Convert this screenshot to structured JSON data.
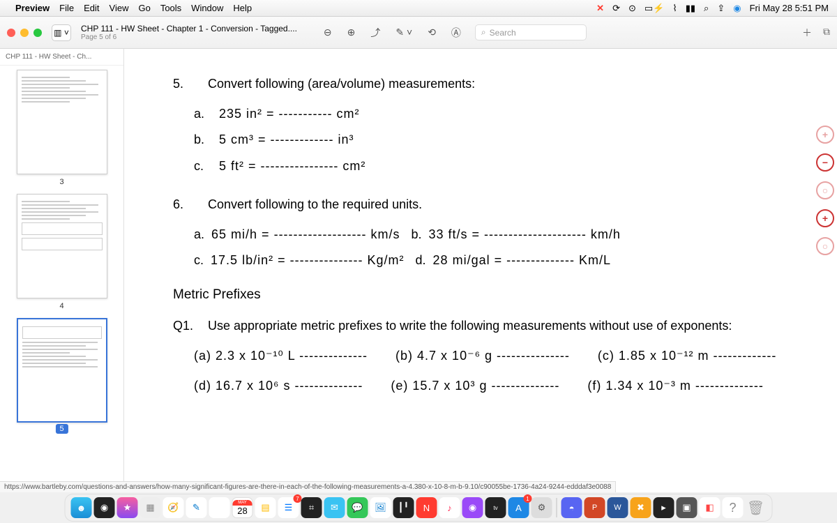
{
  "menubar": {
    "app": "Preview",
    "items": [
      "File",
      "Edit",
      "View",
      "Go",
      "Tools",
      "Window",
      "Help"
    ],
    "datetime": "Fri May 28  5:51 PM"
  },
  "toolbar": {
    "doc_title": "CHP 111 - HW Sheet - Chapter 1 - Conversion - Tagged....",
    "page_info": "Page 5 of 6",
    "search_placeholder": "Search"
  },
  "sidebar": {
    "tab_label": "CHP 111 - HW Sheet - Ch...",
    "thumbs": [
      {
        "num": "3",
        "selected": false
      },
      {
        "num": "4",
        "selected": false
      },
      {
        "num": "5",
        "selected": true
      }
    ]
  },
  "document": {
    "q5": {
      "num": "5.",
      "prompt": "Convert following (area/volume) measurements:",
      "a": {
        "label": "a.",
        "expr": "235 in² = ----------- cm²"
      },
      "b": {
        "label": "b.",
        "expr": "5 cm³ = ------------- in³"
      },
      "c": {
        "label": "c.",
        "expr": "5 ft² = ---------------- cm²"
      }
    },
    "q6": {
      "num": "6.",
      "prompt": "Convert following to the required units.",
      "a": {
        "label": "a.",
        "expr": "65 mi/h = ------------------- km/s"
      },
      "b": {
        "label": "b.",
        "expr": "33 ft/s = --------------------- km/h"
      },
      "c": {
        "label": "c.",
        "expr": "17.5 lb/in² = --------------- Kg/m²"
      },
      "d": {
        "label": "d.",
        "expr": "28 mi/gal = -------------- Km/L"
      }
    },
    "metric_prefixes": {
      "heading": "Metric Prefixes",
      "q1": {
        "num": "Q1.",
        "prompt": "Use appropriate metric prefixes to write the following measurements without use of exponents:",
        "items": [
          "(a) 2.3 x 10⁻¹⁰ L --------------",
          "(b) 4.7 x 10⁻⁶ g ---------------",
          "(c) 1.85 x 10⁻¹² m -------------",
          "(d) 16.7 x 10⁶ s --------------",
          "(e) 15.7 x 10³ g --------------",
          "(f) 1.34 x 10⁻³ m --------------"
        ]
      }
    }
  },
  "url_hint": "https://www.bartleby.com/questions-and-answers/how-many-significant-figures-are-there-in-each-of-the-following-measurements-a-4.380-x-10-8-m-b-9.10/c90055be-1736-4a24-9244-edddaf3e0088",
  "dock": {
    "calendar": {
      "month": "MAY",
      "day": "28"
    },
    "apps": [
      "finder",
      "siri",
      "shortcuts",
      "launchpad",
      "safari",
      "brush",
      "chrome",
      "calendar",
      "notes",
      "reminders",
      "activity",
      "mail",
      "messages",
      "preview",
      "stocks",
      "music-app",
      "podcasts",
      "appletv",
      "appstore",
      "settings",
      "discord",
      "powerpoint",
      "word",
      "xcode",
      "terminal",
      "screenshot",
      "cube",
      "help",
      "trash"
    ]
  }
}
